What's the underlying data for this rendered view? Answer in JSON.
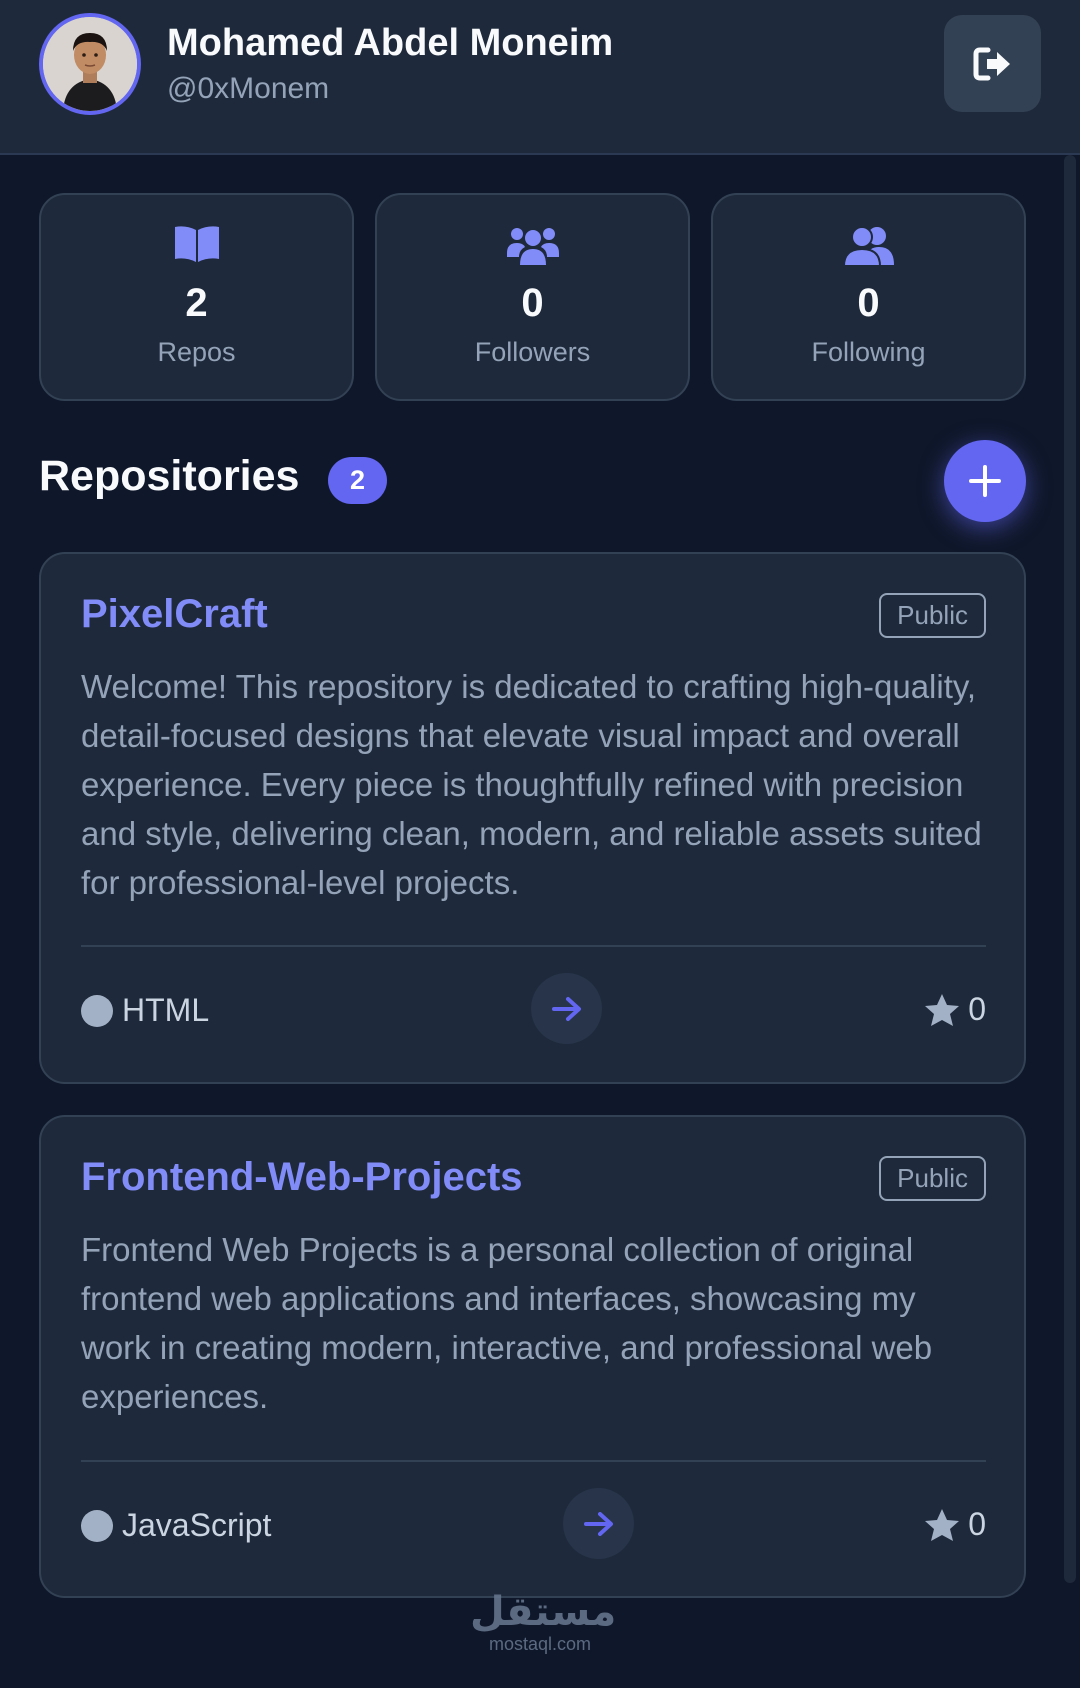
{
  "header": {
    "name": "Mohamed Abdel Moneim",
    "handle": "@0xMonem",
    "logout_icon": "sign-out-icon"
  },
  "stats": [
    {
      "icon": "book-icon",
      "value": "2",
      "label": "Repos"
    },
    {
      "icon": "users-icon",
      "value": "0",
      "label": "Followers"
    },
    {
      "icon": "user-group-icon",
      "value": "0",
      "label": "Following"
    }
  ],
  "repositories": {
    "title": "Repositories",
    "count": "2",
    "add_icon": "plus-icon",
    "items": [
      {
        "name": "PixelCraft",
        "visibility": "Public",
        "description": "Welcome! This repository is dedicated to crafting high-quality, detail-focused designs that elevate visual impact and overall experience. Every piece is thoughtfully refined with precision and style, delivering clean, modern, and reliable assets suited for professional-level projects.",
        "language": "HTML",
        "stars": "0"
      },
      {
        "name": "Frontend-Web-Projects",
        "visibility": "Public",
        "description": "Frontend Web Projects is a personal collection of original frontend web applications and interfaces, showcasing my work in creating modern, interactive, and professional web experiences.",
        "language": "JavaScript",
        "stars": "0"
      }
    ]
  },
  "watermark": {
    "arabic": "مستقل",
    "latin": "mostaql.com"
  },
  "colors": {
    "accent": "#6366f1",
    "link": "#818cf8",
    "background": "#0f172a",
    "card": "#1e293b"
  }
}
